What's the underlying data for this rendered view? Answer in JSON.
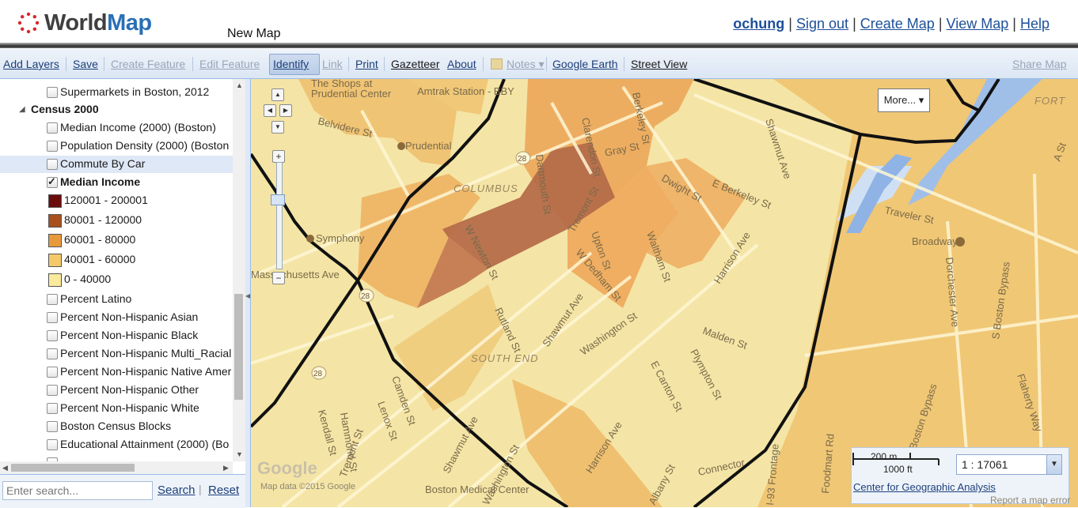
{
  "header": {
    "logo_world": "World",
    "logo_map": "Map",
    "map_title": "New Map",
    "user": "ochung",
    "links": [
      "Sign out",
      "Create Map",
      "View Map",
      "Help"
    ],
    "separator": "|"
  },
  "toolbar": {
    "add_layers": "Add Layers",
    "save": "Save",
    "create_feature": "Create Feature",
    "edit_feature": "Edit Feature",
    "identify": "Identify",
    "link": "Link",
    "print": "Print",
    "gazetteer": "Gazetteer",
    "about": "About",
    "notes": "Notes",
    "google_earth": "Google Earth",
    "street_view": "Street View",
    "share_map": "Share Map"
  },
  "layers": {
    "supermarkets": "Supermarkets in Boston, 2012",
    "group_census": "Census 2000",
    "median_income_boston": "Median Income (2000) (Boston)",
    "population_density": "Population Density (2000) (Boston",
    "commute_by_car": "Commute By Car",
    "median_income": "Median Income",
    "legend": [
      {
        "label": "120001 - 200001",
        "color": "#6b0c0c"
      },
      {
        "label": "80001 - 120000",
        "color": "#a8501e"
      },
      {
        "label": "60001 - 80000",
        "color": "#e89a3a"
      },
      {
        "label": "40001 - 60000",
        "color": "#f3c96a"
      },
      {
        "label": "0 - 40000",
        "color": "#fbe99c"
      }
    ],
    "percent_latino": "Percent Latino",
    "pnh_asian": "Percent Non-Hispanic Asian",
    "pnh_black": "Percent Non-Hispanic Black",
    "pnh_multi": "Percent Non-Hispanic Multi_Racial",
    "pnh_native": "Percent Non-Hispanic Native Amer",
    "pnh_other": "Percent Non-Hispanic Other",
    "pnh_white": "Percent Non-Hispanic White",
    "census_blocks": "Boston Census Blocks",
    "edu_attainment": "Educational Attainment (2000) (Bo"
  },
  "search": {
    "placeholder": "Enter search...",
    "search_label": "Search",
    "reset_label": "Reset"
  },
  "map": {
    "more_button": "More...",
    "scale_m": "200 m",
    "scale_ft": "1000 ft",
    "scale_value": "1 : 17061",
    "credit_link": "Center for Geographic Analysis",
    "google_logo": "Google",
    "map_data": "Map data ©2015 Google",
    "report": "Report a map error",
    "labels": {
      "shops": "The Shops at",
      "prudential_center": "Prudential Center",
      "amtrak": "Amtrak Station - BBY",
      "berkeley": "Berkeley St",
      "clarendon": "Clarendon St",
      "gray": "Gray St",
      "dartmouth": "Dartmouth St",
      "prudential": "Prudential",
      "belvidere": "Belvidere St",
      "columbus": "COLUMBUS",
      "dwight": "Dwight St",
      "e_berkeley": "E Berkeley St",
      "shawmut_top": "Shawmut Ave",
      "traveler": "Traveler St",
      "broadway": "Broadway",
      "w_newton": "W Newton St",
      "tremont_upper": "Tremont St",
      "upton": "Upton St",
      "waltham": "Waltham St",
      "w_dedham": "W Dedham St",
      "symphony": "Symphony",
      "harrison_upper": "Harrison Ave",
      "dorchester": "Dorchester Ave",
      "s_boston_bypass": "S Boston Bypass",
      "rutland": "Rutland St",
      "shawmut_mid": "Shawmut Ave",
      "washington_mid": "Washington St",
      "malden": "Malden St",
      "south_end": "SOUTH END",
      "plympton": "Plympton St",
      "e_canton": "E Canton St",
      "flaherty": "Flaherty Way",
      "tremont_lower": "Tremont St",
      "camden": "Camden St",
      "lenox": "Lenox St",
      "kendall": "Kendall St",
      "hammond": "Hammond St",
      "shawmut_low": "Shawmut Ave",
      "washington_low": "Washington St",
      "harrison_low": "Harrison Ave",
      "albany": "Albany St",
      "boston_medical": "Boston Medical Center",
      "connector": "Connector",
      "i93": "I-93 Frontage",
      "foodmart": "Foodmart Rd",
      "boston_bypass": "Boston Bypass",
      "fort": "FORT",
      "a_st": "A St",
      "mass": "Massachusetts Ave",
      "r28a": "28",
      "r28b": "28",
      "r28c": "28"
    }
  }
}
